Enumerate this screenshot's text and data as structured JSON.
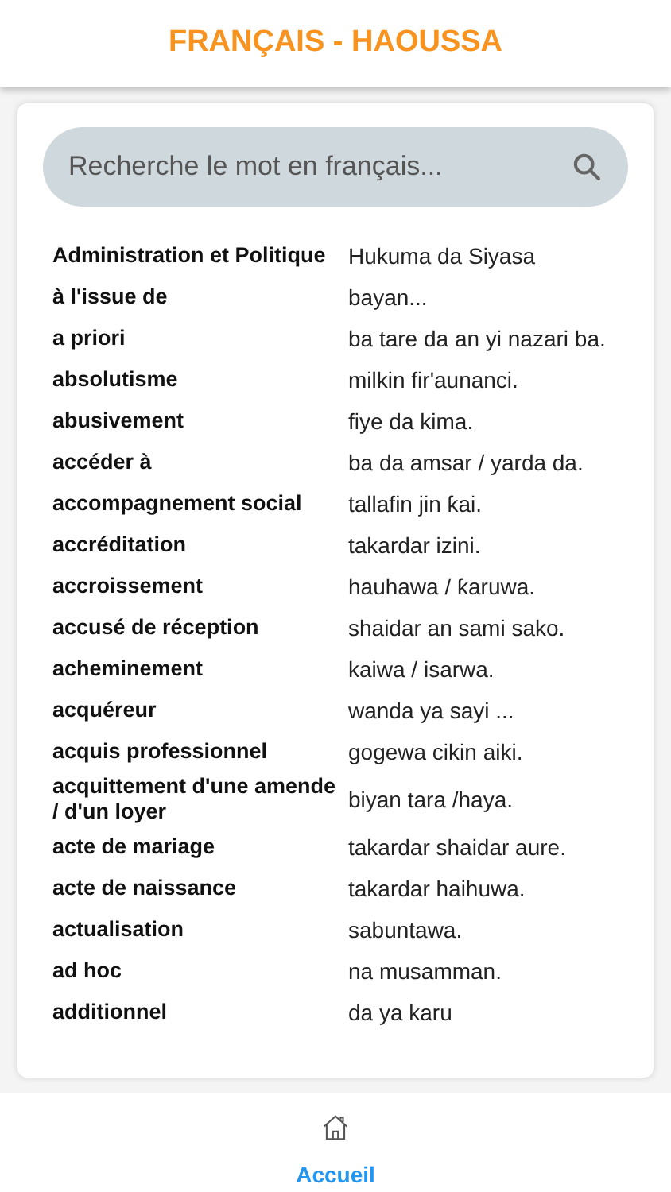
{
  "app_bar": {
    "title": "FRANÇAIS - HAOUSSA"
  },
  "search": {
    "placeholder": "Recherche le mot en français..."
  },
  "entries": [
    {
      "french": "Administration et Politique",
      "hausa": "Hukuma da Siyasa"
    },
    {
      "french": "à l'issue de",
      "hausa": "bayan..."
    },
    {
      "french": "a priori",
      "hausa": "ba tare da an yi nazari ba."
    },
    {
      "french": "absolutisme",
      "hausa": "milkin fir'aunanci."
    },
    {
      "french": "abusivement",
      "hausa": "fiye da kima."
    },
    {
      "french": "accéder à",
      "hausa": "ba da amsar / yarda da."
    },
    {
      "french": "accompagnement social",
      "hausa": "tallafin jin ƙai."
    },
    {
      "french": "accréditation",
      "hausa": "takardar izini."
    },
    {
      "french": "accroissement",
      "hausa": "hauhawa / ƙaruwa."
    },
    {
      "french": "accusé de réception",
      "hausa": "shaidar an sami sako."
    },
    {
      "french": "acheminement",
      "hausa": "kaiwa / isarwa."
    },
    {
      "french": "acquéreur",
      "hausa": "wanda ya sayi ..."
    },
    {
      "french": "acquis professionnel",
      "hausa": "gogewa cikin aiki."
    },
    {
      "french": "acquittement d'une amende / d'un loyer",
      "hausa": "biyan tara /haya."
    },
    {
      "french": "acte de mariage",
      "hausa": "takardar shaidar aure."
    },
    {
      "french": "acte de naissance",
      "hausa": "takardar haihuwa."
    },
    {
      "french": "actualisation",
      "hausa": "sabuntawa."
    },
    {
      "french": "ad hoc",
      "hausa": "na musamman."
    },
    {
      "french": "additionnel",
      "hausa": "da ya karu"
    }
  ],
  "bottom_nav": [
    {
      "label": "Accueil",
      "selected": true
    }
  ]
}
